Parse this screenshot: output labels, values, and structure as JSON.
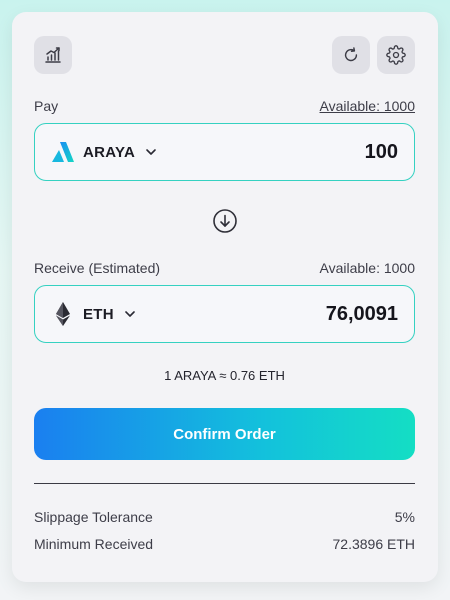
{
  "toolbar": {
    "chart_icon": "chart-icon",
    "refresh_icon": "refresh-icon",
    "settings_icon": "gear-icon"
  },
  "pay": {
    "label": "Pay",
    "available": "Available: 1000",
    "token": "ARAYA",
    "amount": "100",
    "token_icon": "araya-logo-icon"
  },
  "receive": {
    "label": "Receive (Estimated)",
    "available": "Available: 1000",
    "token": "ETH",
    "amount": "76,0091",
    "token_icon": "eth-logo-icon"
  },
  "swap_icon": "arrow-down-circle-icon",
  "rate": "1 ARAYA ≈ 0.76 ETH",
  "confirm_label": "Confirm Order",
  "details": {
    "slippage_label": "Slippage Tolerance",
    "slippage_value": "5%",
    "minimum_label": "Minimum Received",
    "minimum_value": "72.3896 ETH"
  },
  "colors": {
    "accent_teal": "#35d1c1",
    "button_gradient_start": "#1a7ff0",
    "button_gradient_end": "#14dec4",
    "card_background": "#f3f3f6"
  }
}
